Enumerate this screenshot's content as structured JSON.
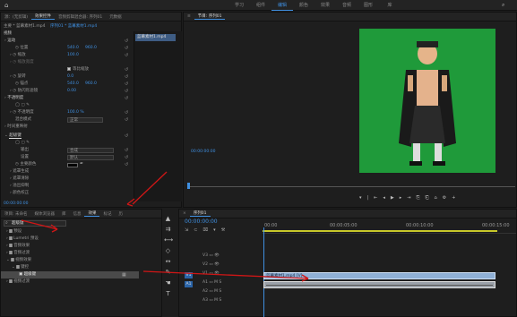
{
  "topbar": {
    "nav": [
      "学习",
      "组件",
      "编辑",
      "颜色",
      "效果",
      "音频",
      "图形",
      "库"
    ],
    "active_index": 2
  },
  "effect_controls": {
    "tabs": [
      "源：(无剪辑)",
      "效果控件",
      "音频剪辑混合器: 序列01",
      "元数据"
    ],
    "active_tab": 1,
    "master": "主要 * 蓝幕素材1.mp4",
    "sequence": "序列01 * 蓝幕素材1.mp4",
    "section_video": "视频",
    "motion": "运动",
    "position_label": "位置",
    "position_x": "540.0",
    "position_y": "960.0",
    "scale_label": "缩放",
    "scale_val": "100.0",
    "scale_width_label": "缩放宽度",
    "uniform_scale_label": "等比缩放",
    "rotation_label": "旋转",
    "rotation_val": "0.0",
    "anchor_label": "锚点",
    "anchor_x": "540.0",
    "anchor_y": "960.0",
    "flicker_label": "防闪烁滤镜",
    "flicker_val": "0.00",
    "opacity_label": "不透明度",
    "opacity_val": "100.0 %",
    "blend_label": "混合模式",
    "blend_val": "正常",
    "time_remap": "时间重映射",
    "ultra_key": "超级键",
    "output_label": "输出",
    "output_val": "合成",
    "setting_label": "设置",
    "setting_val": "默认",
    "key_color_label": "主要颜色",
    "matte_gen": "遮罩生成",
    "matte_clean": "遮罩清除",
    "spill": "溢出抑制",
    "color_correct": "颜色校正",
    "timecode": "00:00:00:00",
    "clip_label": "蓝幕素材1.mp4"
  },
  "program": {
    "tab": "节目: 序列01",
    "timecode": "00:00:00:00"
  },
  "effects_panel": {
    "tabs": [
      "项目: 未命名",
      "媒体浏览器",
      "库",
      "信息",
      "效果",
      "标记",
      "历"
    ],
    "active_tab": 4,
    "search_value": "超级键",
    "folders": [
      "预设",
      "Lumetri 预设",
      "音频效果",
      "音频过渡",
      "视频效果",
      "键控",
      "超级键",
      "视频过渡"
    ]
  },
  "timeline": {
    "tab": "序列01",
    "timecode": "00:00:00:00",
    "ruler": [
      "00:00",
      "00:00:05:00",
      "00:00:10:00",
      "00:00:15:00"
    ],
    "tracks": [
      "V3",
      "V2",
      "V1",
      "A1",
      "A2",
      "A3"
    ],
    "clip_label": "蓝幕素材1.mp4 [V]"
  }
}
